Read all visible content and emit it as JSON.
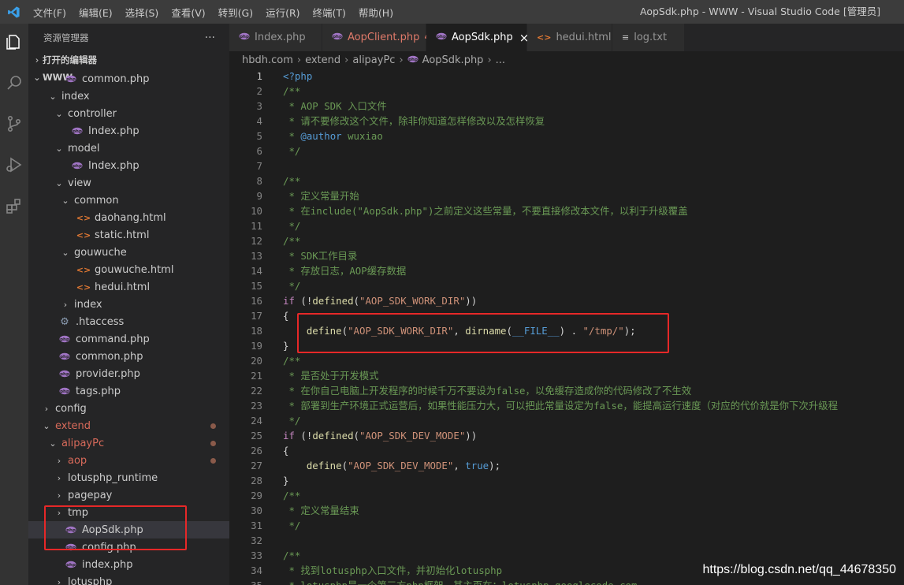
{
  "window": {
    "title": "AopSdk.php - WWW - Visual Studio Code [管理员]",
    "menu": [
      "文件(F)",
      "编辑(E)",
      "选择(S)",
      "查看(V)",
      "转到(G)",
      "运行(R)",
      "终端(T)",
      "帮助(H)"
    ]
  },
  "sidebar": {
    "header": "资源管理器",
    "more": "···",
    "open_editors": "打开的编辑器",
    "workspace": "WWW",
    "tree": [
      {
        "label": "common.php",
        "depth": 3,
        "icon": "php",
        "chev": ""
      },
      {
        "label": "index",
        "depth": 2,
        "icon": "",
        "chev": "⌄"
      },
      {
        "label": "controller",
        "depth": 3,
        "icon": "",
        "chev": "⌄"
      },
      {
        "label": "Index.php",
        "depth": 4,
        "icon": "php",
        "chev": ""
      },
      {
        "label": "model",
        "depth": 3,
        "icon": "",
        "chev": "⌄"
      },
      {
        "label": "Index.php",
        "depth": 4,
        "icon": "php",
        "chev": ""
      },
      {
        "label": "view",
        "depth": 3,
        "icon": "",
        "chev": "⌄"
      },
      {
        "label": "common",
        "depth": 4,
        "icon": "",
        "chev": "⌄"
      },
      {
        "label": "daohang.html",
        "depth": 5,
        "icon": "html",
        "chev": ""
      },
      {
        "label": "static.html",
        "depth": 5,
        "icon": "html",
        "chev": ""
      },
      {
        "label": "gouwuche",
        "depth": 4,
        "icon": "",
        "chev": "⌄"
      },
      {
        "label": "gouwuche.html",
        "depth": 5,
        "icon": "html",
        "chev": ""
      },
      {
        "label": "hedui.html",
        "depth": 5,
        "icon": "html",
        "chev": ""
      },
      {
        "label": "index",
        "depth": 4,
        "icon": "",
        "chev": "›"
      },
      {
        "label": ".htaccess",
        "depth": 2,
        "icon": "gear",
        "chev": ""
      },
      {
        "label": "command.php",
        "depth": 2,
        "icon": "php",
        "chev": ""
      },
      {
        "label": "common.php",
        "depth": 2,
        "icon": "php",
        "chev": ""
      },
      {
        "label": "provider.php",
        "depth": 2,
        "icon": "php",
        "chev": ""
      },
      {
        "label": "tags.php",
        "depth": 2,
        "icon": "php",
        "chev": ""
      },
      {
        "label": "config",
        "depth": 1,
        "icon": "",
        "chev": "›"
      },
      {
        "label": "extend",
        "depth": 1,
        "icon": "",
        "chev": "⌄",
        "red": true,
        "dot": true
      },
      {
        "label": "alipayPc",
        "depth": 2,
        "icon": "",
        "chev": "⌄",
        "red": true,
        "dot": true
      },
      {
        "label": "aop",
        "depth": 3,
        "icon": "",
        "chev": "›",
        "red": true,
        "dot": true
      },
      {
        "label": "lotusphp_runtime",
        "depth": 3,
        "icon": "",
        "chev": "›"
      },
      {
        "label": "pagepay",
        "depth": 3,
        "icon": "",
        "chev": "›"
      },
      {
        "label": "tmp",
        "depth": 3,
        "icon": "",
        "chev": "›"
      },
      {
        "label": "AopSdk.php",
        "depth": 3,
        "icon": "php",
        "chev": "",
        "selected": true
      },
      {
        "label": "config.php",
        "depth": 3,
        "icon": "php",
        "chev": ""
      },
      {
        "label": "index.php",
        "depth": 3,
        "icon": "php",
        "chev": ""
      },
      {
        "label": "lotusphp",
        "depth": 3,
        "icon": "",
        "chev": "›"
      }
    ]
  },
  "tabs": [
    {
      "label": "Index.php",
      "icon": "php"
    },
    {
      "label": "AopClient.php",
      "icon": "php",
      "badge": "4",
      "modified": true
    },
    {
      "label": "AopSdk.php",
      "icon": "php",
      "active": true,
      "close": "×"
    },
    {
      "label": "hedui.html",
      "icon": "html"
    },
    {
      "label": "log.txt",
      "icon": "txt"
    }
  ],
  "breadcrumb": [
    "hbdh.com",
    "extend",
    "alipayPc",
    "AopSdk.php",
    "..."
  ],
  "code_lines": [
    [
      [
        "tag",
        "<?php"
      ]
    ],
    [
      [
        "cmt",
        "/**"
      ]
    ],
    [
      [
        "cmt",
        " * AOP SDK 入口文件"
      ]
    ],
    [
      [
        "cmt",
        " * 请不要修改这个文件，除非你知道怎样修改以及怎样恢复"
      ]
    ],
    [
      [
        "cmt",
        " * "
      ],
      [
        "kw",
        "@author"
      ],
      [
        "cmt",
        " wuxiao"
      ]
    ],
    [
      [
        "cmt",
        " */"
      ]
    ],
    [
      [
        "src",
        ""
      ]
    ],
    [
      [
        "cmt",
        "/**"
      ]
    ],
    [
      [
        "cmt",
        " * 定义常量开始"
      ]
    ],
    [
      [
        "cmt",
        " * 在include(\"AopSdk.php\")之前定义这些常量，不要直接修改本文件，以利于升级覆盖"
      ]
    ],
    [
      [
        "cmt",
        " */"
      ]
    ],
    [
      [
        "cmt",
        "/**"
      ]
    ],
    [
      [
        "cmt",
        " * SDK工作目录"
      ]
    ],
    [
      [
        "cmt",
        " * 存放日志，AOP缓存数据"
      ]
    ],
    [
      [
        "cmt",
        " */"
      ]
    ],
    [
      [
        "ctl",
        "if"
      ],
      [
        "src",
        " (!"
      ],
      [
        "fn",
        "defined"
      ],
      [
        "src",
        "("
      ],
      [
        "str",
        "\"AOP_SDK_WORK_DIR\""
      ],
      [
        "src",
        "))"
      ]
    ],
    [
      [
        "src",
        "{"
      ]
    ],
    [
      [
        "src",
        "    "
      ],
      [
        "fn",
        "define"
      ],
      [
        "src",
        "("
      ],
      [
        "str",
        "\"AOP_SDK_WORK_DIR\""
      ],
      [
        "src",
        ", "
      ],
      [
        "fn",
        "dirname"
      ],
      [
        "src",
        "("
      ],
      [
        "kw",
        "__FILE__"
      ],
      [
        "src",
        ") . "
      ],
      [
        "str",
        "\"/tmp/\""
      ],
      [
        "src",
        ");"
      ]
    ],
    [
      [
        "src",
        "}"
      ]
    ],
    [
      [
        "cmt",
        "/**"
      ]
    ],
    [
      [
        "cmt",
        " * 是否处于开发模式"
      ]
    ],
    [
      [
        "cmt",
        " * 在你自己电脑上开发程序的时候千万不要设为false，以免缓存造成你的代码修改了不生效"
      ]
    ],
    [
      [
        "cmt",
        " * 部署到生产环境正式运营后，如果性能压力大，可以把此常量设定为false，能提高运行速度（对应的代价就是你下次升级程"
      ]
    ],
    [
      [
        "cmt",
        " */"
      ]
    ],
    [
      [
        "ctl",
        "if"
      ],
      [
        "src",
        " (!"
      ],
      [
        "fn",
        "defined"
      ],
      [
        "src",
        "("
      ],
      [
        "str",
        "\"AOP_SDK_DEV_MODE\""
      ],
      [
        "src",
        "))"
      ]
    ],
    [
      [
        "src",
        "{"
      ]
    ],
    [
      [
        "src",
        "    "
      ],
      [
        "fn",
        "define"
      ],
      [
        "src",
        "("
      ],
      [
        "str",
        "\"AOP_SDK_DEV_MODE\""
      ],
      [
        "src",
        ", "
      ],
      [
        "kw",
        "true"
      ],
      [
        "src",
        ");"
      ]
    ],
    [
      [
        "src",
        "}"
      ]
    ],
    [
      [
        "cmt",
        "/**"
      ]
    ],
    [
      [
        "cmt",
        " * 定义常量结束"
      ]
    ],
    [
      [
        "cmt",
        " */"
      ]
    ],
    [
      [
        "src",
        ""
      ]
    ],
    [
      [
        "cmt",
        "/**"
      ]
    ],
    [
      [
        "cmt",
        " * 找到lotusphp入口文件，并初始化lotusphp"
      ]
    ],
    [
      [
        "cmt",
        " * lotusphp是一个第三方php框架，其主页在：lotusphp.googlecode.com"
      ]
    ]
  ],
  "current_line": 1,
  "watermark": "https://blog.csdn.net/qq_44678350",
  "colors": {
    "accent_red": "#e62828",
    "php_icon": "#a074c4",
    "html_icon": "#e37933"
  }
}
